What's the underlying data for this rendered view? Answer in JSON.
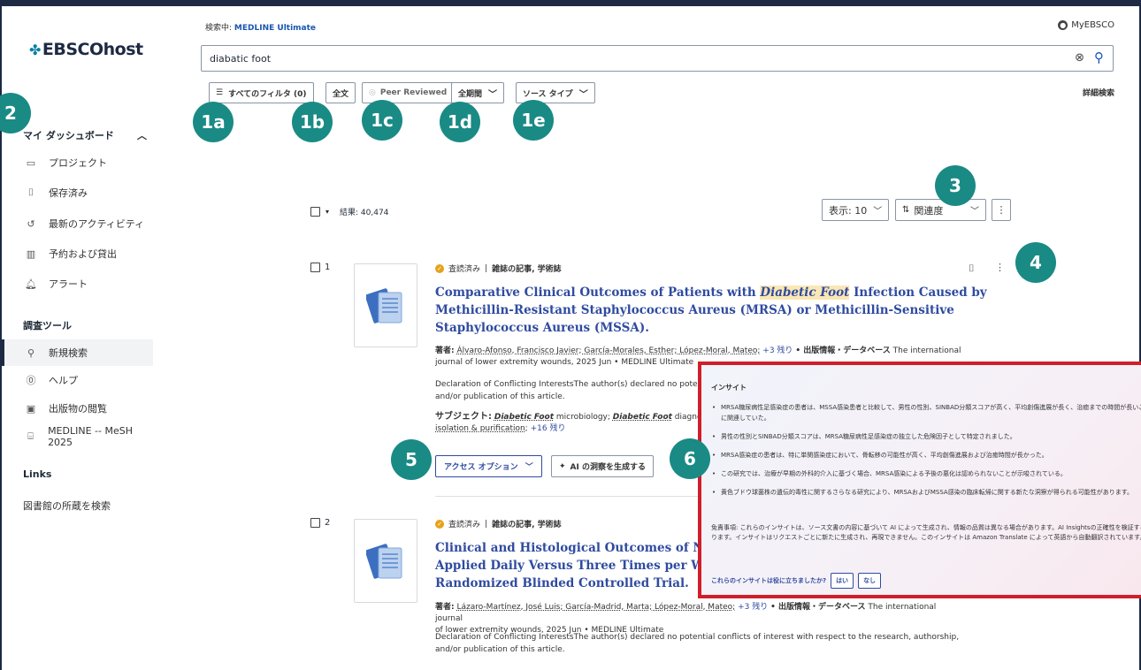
{
  "header": {
    "searching_in_label": "検索中:",
    "searching_in_db": "MEDLINE Ultimate",
    "account": "MyEBSCO",
    "search_value": "diabatic foot",
    "advanced_search": "詳細検索"
  },
  "filters": {
    "all_filters": "すべてのフィルタ (0)",
    "full_text": "全文",
    "peer_reviewed": "Peer Reviewed",
    "all_time": "全期間",
    "source_type": "ソース タイプ"
  },
  "badges": {
    "b1a": "1a",
    "b1b": "1b",
    "b1c": "1c",
    "b1d": "1d",
    "b1e": "1e",
    "b2": "2",
    "b3": "3",
    "b4": "4",
    "b5": "5",
    "b6": "6"
  },
  "sidebar": {
    "logo": "EBSCOhost",
    "dashboard": "マイ ダッシュボード",
    "items": [
      {
        "label": "プロジェクト"
      },
      {
        "label": "保存済み"
      },
      {
        "label": "最新のアクティビティ"
      },
      {
        "label": "予約および貸出"
      },
      {
        "label": "アラート"
      }
    ],
    "tools_head": "調査ツール",
    "tools": [
      {
        "label": "新規検索"
      },
      {
        "label": "ヘルプ"
      },
      {
        "label": "出版物の閲覧"
      },
      {
        "label": "MEDLINE -- MeSH 2025"
      }
    ],
    "links_head": "Links",
    "links": [
      {
        "label": "図書館の所蔵を検索"
      }
    ]
  },
  "results": {
    "count": "結果: 40,474",
    "page_size": "表示: 10",
    "sort": "関連度"
  },
  "items": [
    {
      "num": "1",
      "status": "査読済み",
      "type": "雑誌の記事, 学術誌",
      "title_pre": "Comparative Clinical Outcomes of Patients with ",
      "title_hl": "Diabetic Foot",
      "title_post1": " Infection Caused by",
      "title_line2": "Methicillin-Resistant Staphylococcus Aureus (MRSA) or Methicillin-Sensitive",
      "title_line3": "Staphylococcus Aureus (MSSA).",
      "authors_label": "著者:",
      "authors": "Álvaro-Afonso, Francisco Javier; García-Morales, Esther; López-Moral, Mateo;",
      "authors_more": "+3 残り",
      "pub_label": "• 出版情報・データベース",
      "pub": "The international",
      "pub_line2": "journal of lower extremity wounds, 2025 Jun • MEDLINE Ultimate",
      "desc1": "Declaration of Conflicting InterestsThe author(s) declared no poten",
      "desc2": "and/or publication of this article.",
      "subj_label": "サブジェクト:",
      "subj1": "Diabetic Foot",
      "subj1_rest": " microbiology; ",
      "subj2": "Diabetic Foot",
      "subj2_rest": " diagnosis;",
      "subj_line2": "isolation & purification;",
      "subj_more": "+16 残り",
      "access": "アクセス オプション",
      "ai": "AI の洞察を生成する"
    },
    {
      "num": "2",
      "status": "査読済み",
      "type": "雑誌の記事, 学術誌",
      "title_line1": "Clinical and Histological Outcomes of Nega",
      "title_line2": "Applied Daily Versus Three Times per Week",
      "title_line3": "Randomized Blinded Controlled Trial.",
      "authors_label": "著者:",
      "authors": "Lázaro-Martínez, José Luis; García-Madrid, Marta; López-Moral, Mateo;",
      "authors_more": "+3 残り",
      "pub_label": "• 出版情報・データベース",
      "pub": "The international journal",
      "pub_line2": "of lower extremity wounds, 2025 Jun • MEDLINE Ultimate",
      "desc1": "Declaration of Conflicting InterestsThe author(s) declared no potential conflicts of interest with respect to the research, authorship,",
      "desc2": "and/or publication of this article."
    }
  ],
  "insight": {
    "title": "インサイト",
    "points": [
      "MRSA糖尿病性足感染症の患者は、MSSA感染患者と比較して、男性の性別、SINBAD分類スコアが高く、平均創傷進展が長く、治癒までの時間が長いことと有意に関連していた。",
      "男性の性別とSINBAD分類スコアは、MRSA糖尿病性足感染症の独立した危険因子として特定されました。",
      "MRSA感染症の患者は、特に単関感染症において、骨転移の可能性が高く、平均創傷進展および治癒時間が長かった。",
      "この研究では、治療が早期の外科的介入に基づく場合、MRSA感染による予後の悪化は認められないことが示唆されている。",
      "黄色ブドウ球菌株の遺伝的毒性に関するさらなる研究により、MRSAおよびMSSA感染の臨床転帰に関する新たな洞察が得られる可能性があります。"
    ],
    "disclaimer": "免責事項: これらのインサイトは、ソース文書の内容に基づいて AI によって生成され、情報の品質は異なる場合があります。AI Insightsの正確性を検証する必要があります。インサイトはリクエストごとに新たに生成され、再現できません。このインサイトは Amazon Translate によって英語から自動翻訳されています。",
    "feedback_q": "これらのインサイトは役に立ちましたか?",
    "yes": "はい",
    "no": "なし"
  }
}
